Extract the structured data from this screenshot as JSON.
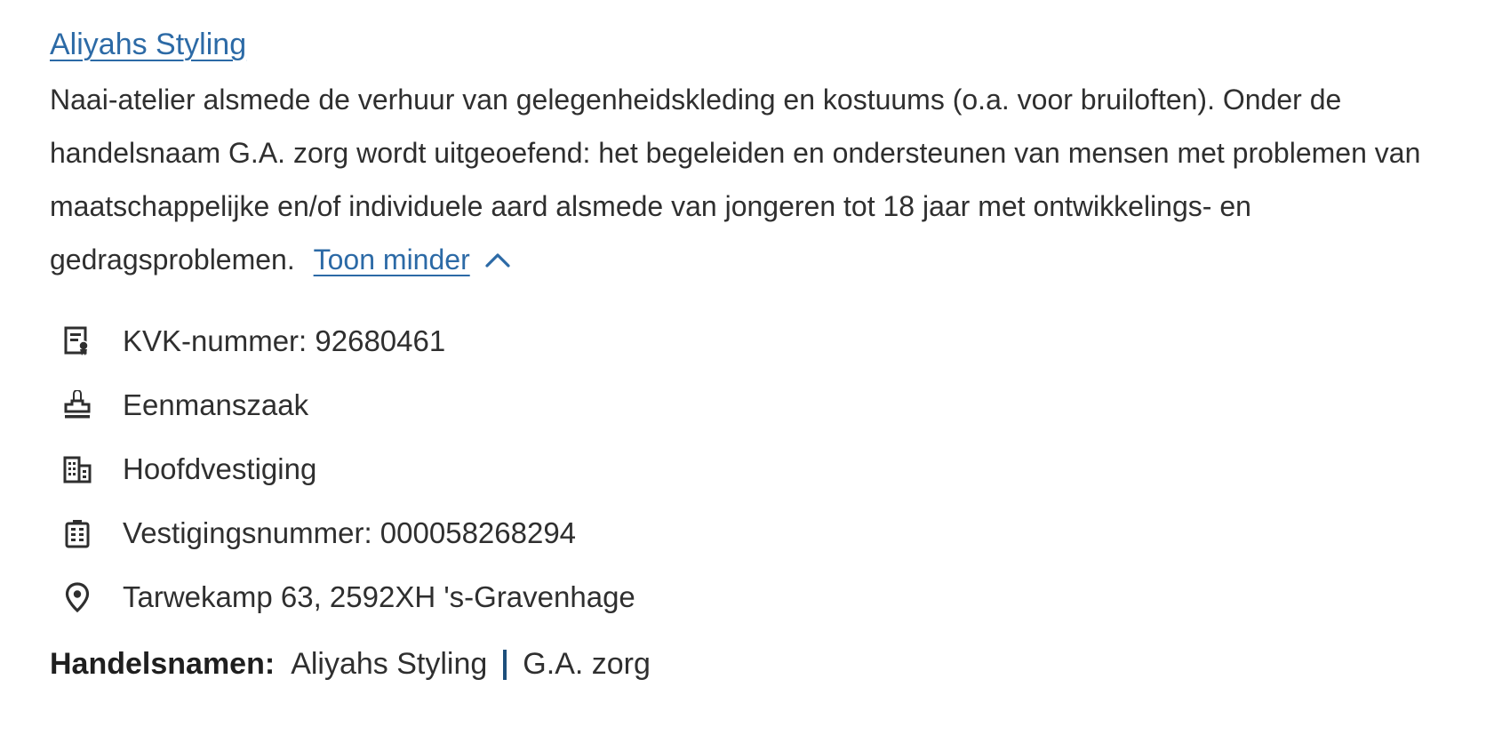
{
  "company": {
    "name": "Aliyahs Styling",
    "description": "Naai-atelier alsmede de verhuur van gelegenheidskleding en kostuums (o.a. voor bruiloften). Onder de handelsnaam G.A. zorg wordt uitgeoefend: het begeleiden en ondersteunen van mensen met problemen van maatschappelijke en/of individuele aard alsmede van jongeren tot 18 jaar met ontwikkelings- en gedragsproblemen.",
    "toggle_label": "Toon minder"
  },
  "facts": [
    {
      "icon": "certificate-icon",
      "text": "KVK-nummer: 92680461"
    },
    {
      "icon": "stamp-icon",
      "text": "Eenmanszaak"
    },
    {
      "icon": "building-icon",
      "text": "Hoofdvestiging"
    },
    {
      "icon": "office-building-icon",
      "text": "Vestigingsnummer: 000058268294"
    },
    {
      "icon": "location-pin-icon",
      "text": "Tarwekamp 63, 2592XH 's-Gravenhage"
    }
  ],
  "tradenames": {
    "label": "Handelsnamen:",
    "names": [
      "Aliyahs Styling",
      "G.A. zorg"
    ]
  },
  "colors": {
    "link": "#2c6aa6",
    "text": "#2f2f2f",
    "separator": "#1d4f7c"
  }
}
